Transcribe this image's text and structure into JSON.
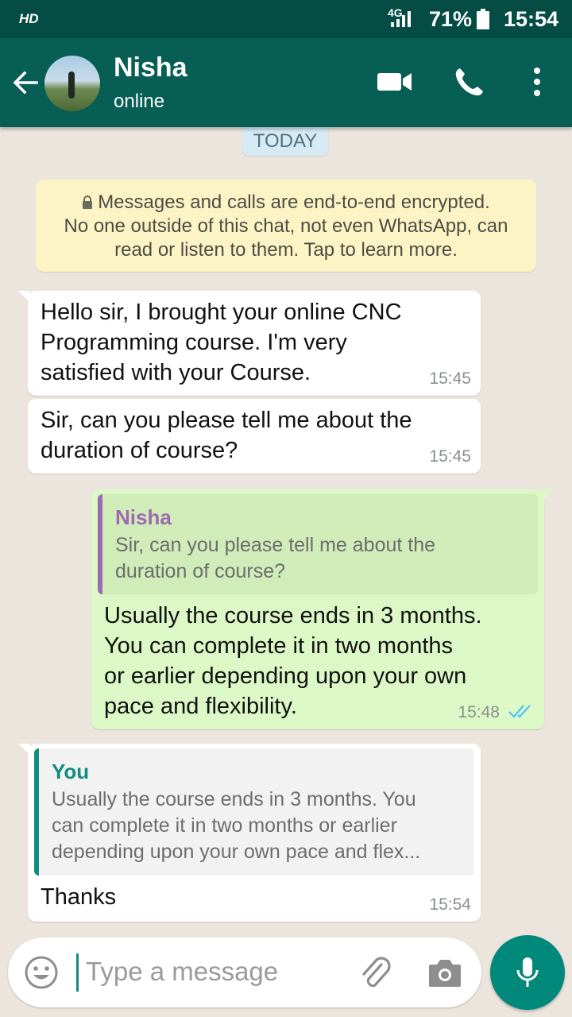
{
  "status_bar": {
    "hd": "HD",
    "network": "4G",
    "battery": "71%",
    "time": "15:54"
  },
  "header": {
    "contact_name": "Nisha",
    "contact_status": "online"
  },
  "chat": {
    "date_chip": "TODAY",
    "encryption_notice": {
      "line1": "Messages and calls are end-to-end encrypted.",
      "line2": "No one outside of this chat, not even WhatsApp, can",
      "line3": "read or listen to them. Tap to learn more."
    },
    "messages": [
      {
        "direction": "incoming",
        "lines": [
          "Hello sir, I brought your online CNC",
          "Programming course. I'm very",
          "satisfied with your Course."
        ],
        "time": "15:45"
      },
      {
        "direction": "incoming",
        "lines": [
          "Sir, can you please tell me about the",
          "duration of course?"
        ],
        "time": "15:45"
      },
      {
        "direction": "outgoing",
        "quote": {
          "name": "Nisha",
          "lines": [
            "Sir, can you please tell me about the",
            "duration of course?"
          ]
        },
        "lines": [
          "Usually the course ends in 3 months.",
          "You can complete it in two months",
          "or earlier depending upon your own",
          "pace and flexibility."
        ],
        "time": "15:48",
        "status": "read"
      },
      {
        "direction": "incoming",
        "quote": {
          "name": "You",
          "lines": [
            "Usually the course ends in 3 months. You",
            "can complete it in two months or earlier",
            "depending upon your own pace and flex..."
          ]
        },
        "lines": [
          "Thanks"
        ],
        "time": "15:54"
      }
    ]
  },
  "composer": {
    "placeholder": "Type a message"
  },
  "colors": {
    "header": "#075e54",
    "status_bar": "#054d44",
    "outgoing_bubble": "#dcf8c6",
    "incoming_bubble": "#ffffff",
    "accent": "#00897b",
    "quote_incoming_name": "#9c6bae",
    "quote_you_name": "#128c7e",
    "read_ticks": "#4fc3f7"
  },
  "icons": [
    "back-arrow-icon",
    "video-call-icon",
    "phone-icon",
    "more-options-icon",
    "lock-icon",
    "read-ticks-icon",
    "emoji-icon",
    "attach-icon",
    "camera-icon",
    "mic-icon"
  ]
}
